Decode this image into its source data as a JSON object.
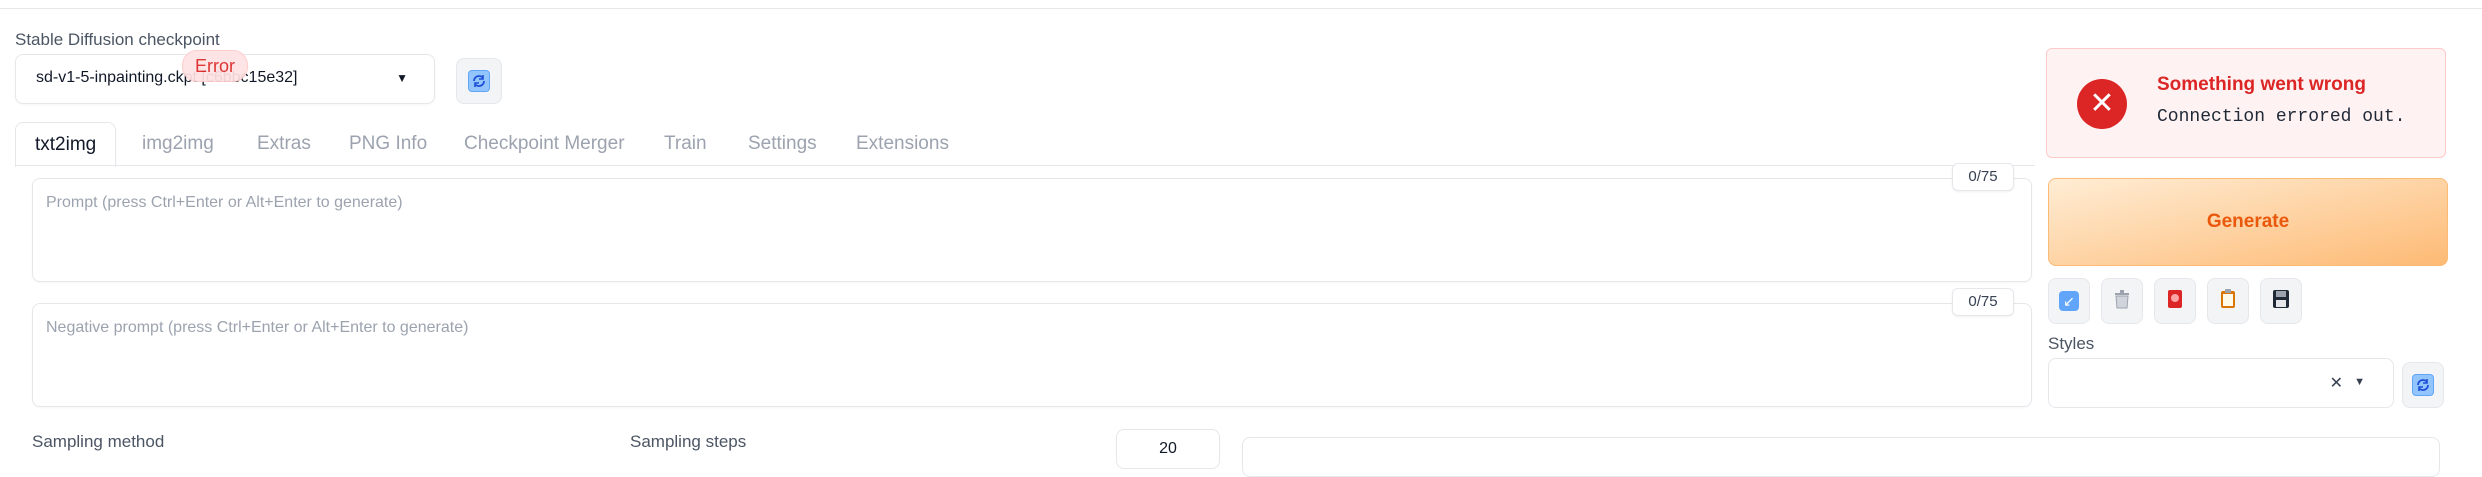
{
  "checkpoint": {
    "label": "Stable Diffusion checkpoint",
    "value": "sd-v1-5-inpainting.ckpt [c6bbc15e32]",
    "refresh_icon": "refresh-icon"
  },
  "error_chip": "Error",
  "tabs": [
    {
      "label": "txt2img",
      "active": true
    },
    {
      "label": "img2img",
      "active": false
    },
    {
      "label": "Extras",
      "active": false
    },
    {
      "label": "PNG Info",
      "active": false
    },
    {
      "label": "Checkpoint Merger",
      "active": false
    },
    {
      "label": "Train",
      "active": false
    },
    {
      "label": "Settings",
      "active": false
    },
    {
      "label": "Extensions",
      "active": false
    }
  ],
  "prompt": {
    "placeholder": "Prompt (press Ctrl+Enter or Alt+Enter to generate)",
    "counter": "0/75"
  },
  "negative_prompt": {
    "placeholder": "Negative prompt (press Ctrl+Enter or Alt+Enter to generate)",
    "counter": "0/75"
  },
  "toast": {
    "title": "Something went wrong",
    "message": "Connection errored out.",
    "icon_glyph": "✕"
  },
  "generate": {
    "label": "Generate"
  },
  "tool_buttons": [
    {
      "icon": "arrow-icon",
      "glyph": "↙"
    },
    {
      "icon": "trash-icon",
      "glyph": "🗑"
    },
    {
      "icon": "extra-networks-icon",
      "glyph": "🎴"
    },
    {
      "icon": "clipboard-icon",
      "glyph": "📋"
    },
    {
      "icon": "save-icon",
      "glyph": "💾"
    }
  ],
  "styles": {
    "label": "Styles",
    "clear_glyph": "✕",
    "caret_glyph": "▼",
    "refresh_icon": "refresh-icon"
  },
  "sampling_method": {
    "label": "Sampling method"
  },
  "sampling_steps": {
    "label": "Sampling steps",
    "value": "20"
  },
  "colors": {
    "accent": "#ea580c",
    "error": "#dc2626",
    "border": "#e5e7eb",
    "refresh_bg": "#93c5fd",
    "refresh_accent": "#1d4ed8"
  }
}
